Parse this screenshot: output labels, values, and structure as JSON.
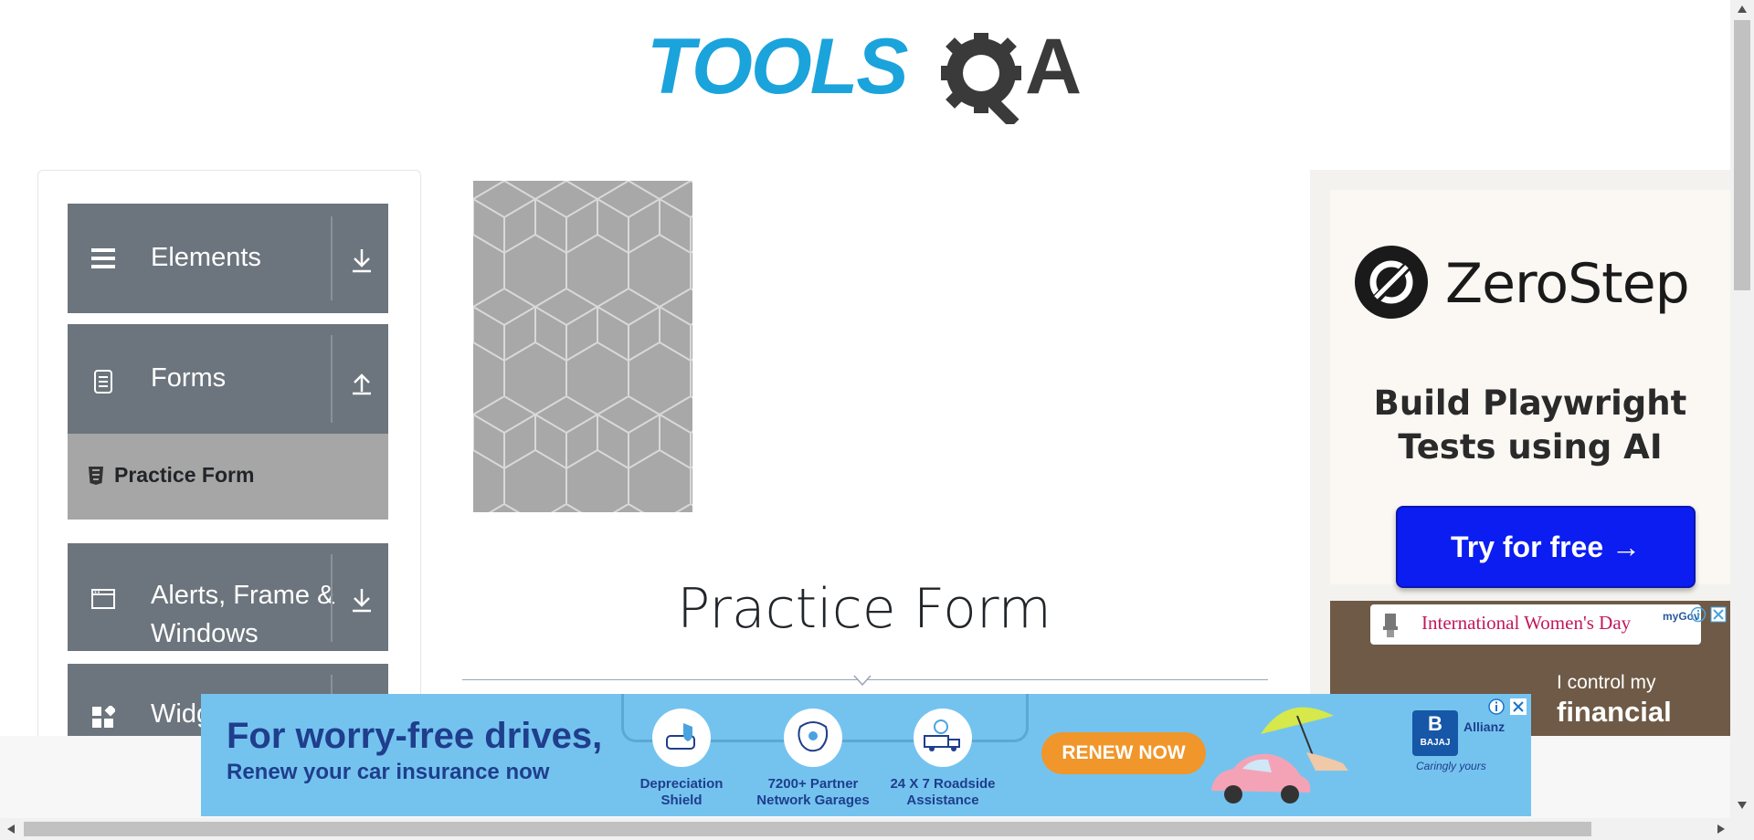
{
  "header": {
    "logo_text_left": "TOOLS",
    "logo_text_right": "A"
  },
  "sidebar": {
    "groups": [
      {
        "label": "Elements",
        "icon": "menu-icon",
        "toggle": "download-icon"
      },
      {
        "label": "Forms",
        "icon": "document-icon",
        "toggle": "upload-icon"
      },
      {
        "label": "Alerts, Frame &",
        "label2": "Windows",
        "icon": "window-icon",
        "toggle": "download-icon"
      },
      {
        "label": "Widgets",
        "icon": "widgets-icon",
        "toggle": "download-icon"
      }
    ],
    "active_item": {
      "label": "Practice Form",
      "icon": "html5-icon"
    }
  },
  "main": {
    "title": "Practice Form"
  },
  "right_ad": {
    "brand": "ZeroStep",
    "headline_line1": "Build Playwright",
    "headline_line2": "Tests using AI",
    "cta": "Try for free →",
    "banner_text": "International Women's Day",
    "mygov": "myGov",
    "quote_line1": "I control my",
    "quote_line2": "financial"
  },
  "bottom_ad": {
    "headline": "For worry-free drives,",
    "subheadline": "Renew your car insurance now",
    "features": [
      {
        "line1": "Depreciation",
        "line2": "Shield"
      },
      {
        "line1": "7200+ Partner",
        "line2": "Network Garages"
      },
      {
        "line1": "24 X 7 Roadside",
        "line2": "Assistance"
      }
    ],
    "cta": "RENEW NOW",
    "brand": "BAJAJ",
    "partner": "Allianz",
    "tagline": "Caringly yours"
  },
  "colors": {
    "logo_blue": "#1ba3dc",
    "logo_dark": "#3a3a3a",
    "sidebar_group": "#6c757d",
    "sidebar_active": "#a6a6a6",
    "cta_blue": "#0b1df0",
    "renew_orange": "#f0962b"
  }
}
